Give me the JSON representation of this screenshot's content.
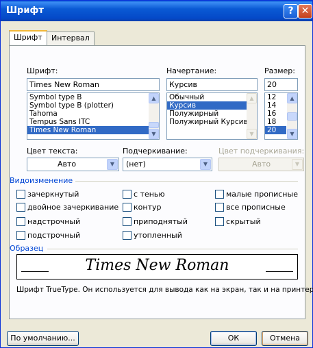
{
  "window": {
    "title": "Шрифт",
    "help_icon": "?",
    "close_icon": "✕"
  },
  "tabs": [
    {
      "label": "Шрифт",
      "active": true
    },
    {
      "label": "Интервал",
      "active": false
    }
  ],
  "font": {
    "label": "Шрифт:",
    "value": "Times New Roman",
    "items": [
      "Symbol type B",
      "Symbol type B (plotter)",
      "Tahoma",
      "Tempus Sans ITC",
      "Times New Roman"
    ],
    "selected": "Times New Roman"
  },
  "style": {
    "label": "Начертание:",
    "value": "Курсив",
    "items": [
      "Обычный",
      "Курсив",
      "Полужирный",
      "Полужирный Курсив"
    ],
    "selected": "Курсив"
  },
  "size": {
    "label": "Размер:",
    "value": "20",
    "items": [
      "12",
      "14",
      "16",
      "18",
      "20"
    ],
    "selected": "20"
  },
  "text_color": {
    "label": "Цвет текста:",
    "value": "Авто"
  },
  "underline": {
    "label": "Подчеркивание:",
    "value": "(нет)"
  },
  "underline_color": {
    "label": "Цвет подчеркивания:",
    "value": "Авто"
  },
  "effects": {
    "title": "Видоизменение",
    "options": [
      {
        "label": "зачеркнутый",
        "checked": false
      },
      {
        "label": "двойное зачеркивание",
        "checked": false
      },
      {
        "label": "надстрочный",
        "checked": false
      },
      {
        "label": "подстрочный",
        "checked": false
      },
      {
        "label": "с тенью",
        "checked": false
      },
      {
        "label": "контур",
        "checked": false
      },
      {
        "label": "приподнятый",
        "checked": false
      },
      {
        "label": "утопленный",
        "checked": false
      },
      {
        "label": "малые прописные",
        "checked": false
      },
      {
        "label": "все прописные",
        "checked": false
      },
      {
        "label": "скрытый",
        "checked": false
      }
    ]
  },
  "sample": {
    "title": "Образец",
    "text": "Times New Roman",
    "note": "Шрифт TrueType. Он используется для вывода как на экран, так и на принтер."
  },
  "buttons": {
    "default": "По умолчанию...",
    "ok": "ОК",
    "cancel": "Отмена"
  },
  "colors": {
    "titlebar": "#0a5ad4",
    "selection": "#316ac5",
    "group_title": "#0046d5"
  }
}
